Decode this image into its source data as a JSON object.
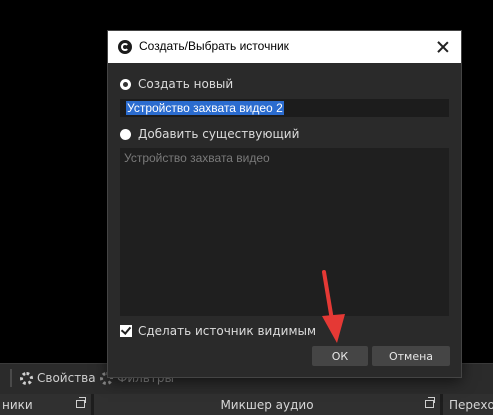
{
  "background": {
    "toolbar": {
      "properties_label": "Свойства",
      "filters_label": "Фильтры"
    },
    "docks": {
      "sources_header": "ники",
      "mixer_header": "Микшер аудио",
      "transitions_header": "Перехо"
    }
  },
  "dialog": {
    "title": "Создать/Выбрать источник",
    "create_new_label": "Создать новый",
    "name_value": "Устройство захвата видео 2",
    "add_existing_label": "Добавить существующий",
    "existing_items": [
      "Устройство захвата видео"
    ],
    "make_visible_label": "Сделать источник видимым",
    "ok_label": "ОК",
    "cancel_label": "Отмена"
  },
  "colors": {
    "accent_selection": "#2b6ccf",
    "annotation_arrow": "#e53935"
  }
}
